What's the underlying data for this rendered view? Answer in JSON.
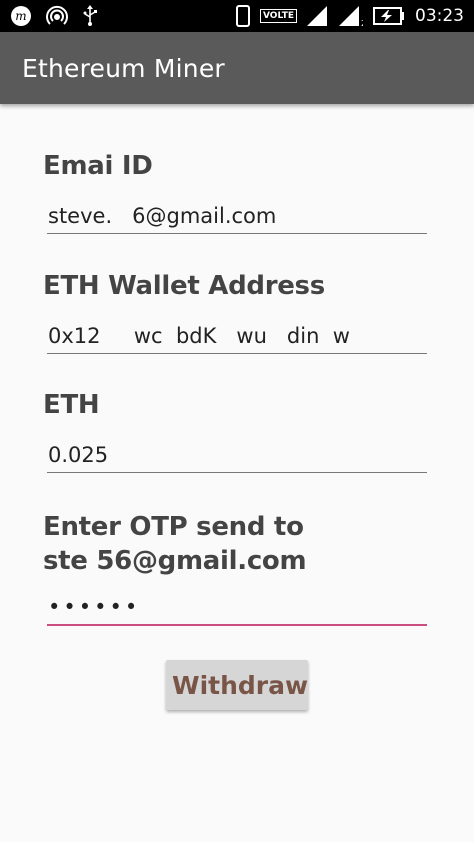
{
  "status_bar": {
    "time": "03:23",
    "volte": "VOLTE",
    "left_icons": [
      "m-app-icon",
      "hotspot-icon",
      "usb-icon"
    ],
    "right_icons": [
      "phone-icon",
      "signal-icon",
      "signal-2-icon",
      "battery-charging-icon"
    ]
  },
  "app_bar": {
    "title": "Ethereum Miner"
  },
  "form": {
    "email": {
      "label": "Emai ID",
      "value": "steve.   6@gmail.com"
    },
    "wallet": {
      "label": "ETH Wallet Address",
      "value": "0x12     wc  bdK   wu   din  w"
    },
    "eth": {
      "label": "ETH",
      "value": "0.025"
    },
    "otp": {
      "label_line1": "Enter OTP send to",
      "label_line2": "ste     56@gmail.com",
      "value": "••••••"
    },
    "withdraw_label": "Withdraw"
  },
  "colors": {
    "app_bar": "#5a5a5a",
    "accent": "#cc4d7f",
    "button_text": "#795548",
    "label": "#444444"
  }
}
